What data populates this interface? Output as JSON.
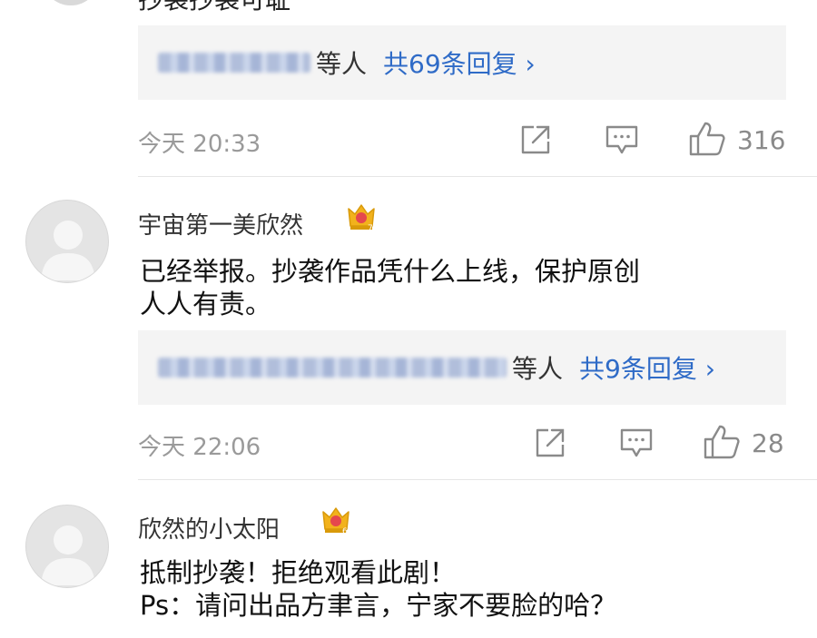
{
  "top_comment": {
    "partial_text": "抄袭抄袭可耻",
    "reply_preview": {
      "etc": "等人",
      "total": "共69条回复 ›"
    },
    "time": {
      "day": "今天",
      "clock": "20:33"
    },
    "likes": "316"
  },
  "comments": [
    {
      "username": "宇宙第一美欣然",
      "badge_level": "7",
      "content_lines": [
        "已经举报。抄袭作品凭什么上线，保护原创",
        "人人有责。"
      ],
      "reply_preview": {
        "etc": "等人",
        "total": "共9条回复 ›"
      },
      "time": {
        "day": "今天",
        "clock": "22:06"
      },
      "likes": "28"
    },
    {
      "username": "欣然的小太阳",
      "badge_level": "6",
      "content_lines": [
        "抵制抄袭！拒绝观看此剧！",
        "Ps：请问出品方聿言，宁家不要脸的哈？"
      ]
    }
  ],
  "icons": {
    "share": "share-icon",
    "comment": "comment-icon",
    "like": "thumbs-up-icon",
    "avatar": "default-avatar-icon",
    "badge": "crown-badge-icon"
  },
  "colors": {
    "link": "#2f6bc7",
    "badge_gold": "#f2b21c",
    "badge_red": "#e5484d",
    "meta_gray": "#9a9a9a"
  }
}
